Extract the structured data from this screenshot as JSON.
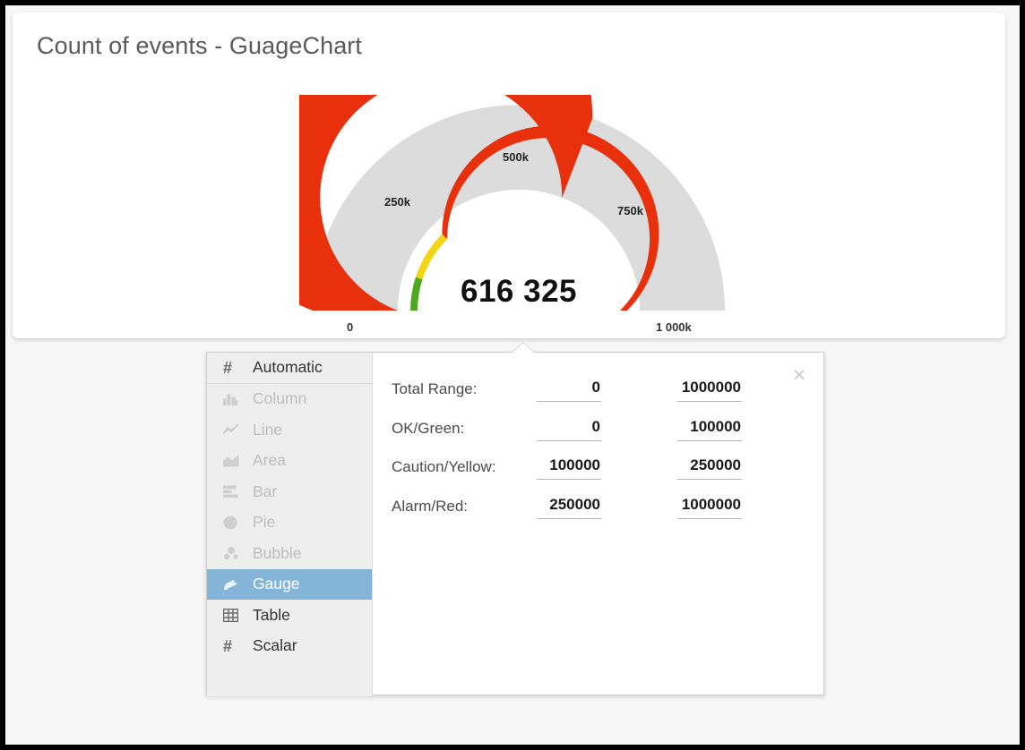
{
  "chart_card": {
    "title": "Count of events - GuageChart"
  },
  "chart_data": {
    "type": "gauge",
    "title": "Count of events - GuageChart",
    "value": 616325,
    "value_label": "616 325",
    "min": 0,
    "max": 1000000,
    "axis_tick_labels": [
      "0",
      "250k",
      "500k",
      "750k",
      "1 000k"
    ],
    "axis_tick_values": [
      0,
      250000,
      500000,
      750000,
      1000000
    ],
    "outer_arc": {
      "description": "value fill arc",
      "filled_fraction": 0.616325,
      "fill_color": "#e8310c",
      "track_color": "#dcdcdc"
    },
    "inner_arc": {
      "description": "threshold band arc",
      "bands": [
        {
          "name": "OK/Green",
          "from": 0,
          "to": 100000,
          "color": "#4fa81f"
        },
        {
          "name": "Caution/Yellow",
          "from": 100000,
          "to": 250000,
          "color": "#f2d513"
        },
        {
          "name": "Alarm/Red",
          "from": 250000,
          "to": 1000000,
          "color": "#e8310c"
        }
      ]
    },
    "colors": {
      "red": "#e8310c",
      "yellow": "#f2d513",
      "green": "#4fa81f",
      "gray_track": "#dcdcdc"
    }
  },
  "settings_popup": {
    "close_label": "×",
    "chart_types": [
      {
        "label": "Automatic",
        "icon": "hash-icon",
        "state": "enabled"
      },
      {
        "label": "Column",
        "icon": "column-icon",
        "state": "disabled"
      },
      {
        "label": "Line",
        "icon": "line-icon",
        "state": "disabled"
      },
      {
        "label": "Area",
        "icon": "area-icon",
        "state": "disabled"
      },
      {
        "label": "Bar",
        "icon": "bar-icon",
        "state": "disabled"
      },
      {
        "label": "Pie",
        "icon": "pie-icon",
        "state": "disabled"
      },
      {
        "label": "Bubble",
        "icon": "bubble-icon",
        "state": "disabled"
      },
      {
        "label": "Gauge",
        "icon": "gauge-icon",
        "state": "selected"
      },
      {
        "label": "Table",
        "icon": "table-icon",
        "state": "enabled"
      },
      {
        "label": "Scalar",
        "icon": "hash-icon",
        "state": "enabled"
      }
    ],
    "range_rows": [
      {
        "label": "Total Range:",
        "min": "0",
        "max": "1000000"
      },
      {
        "label": "OK/Green:",
        "min": "0",
        "max": "100000"
      },
      {
        "label": "Caution/Yellow:",
        "min": "100000",
        "max": "250000"
      },
      {
        "label": "Alarm/Red:",
        "min": "250000",
        "max": "1000000"
      }
    ]
  }
}
